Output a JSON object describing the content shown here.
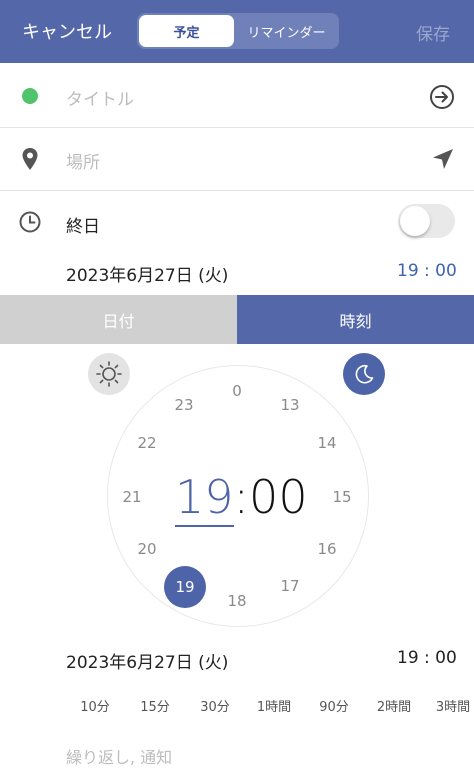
{
  "header": {
    "cancel": "キャンセル",
    "tab_event": "予定",
    "tab_reminder": "リマインダー",
    "save": "保存"
  },
  "title_row": {
    "placeholder": "タイトル",
    "color_dot": "#4fc46c",
    "icon": "arrow-right-circle-icon"
  },
  "location_row": {
    "placeholder": "場所",
    "icon": "location-arrow-icon"
  },
  "allday_row": {
    "label": "終日",
    "toggle_on": false
  },
  "start": {
    "date": "2023年6月27日 (火)",
    "time": "19 : 00"
  },
  "picker_tabs": {
    "date": "日付",
    "time": "時刻",
    "active": "time"
  },
  "clock": {
    "hours": [
      "0",
      "13",
      "14",
      "15",
      "16",
      "17",
      "18",
      "19",
      "20",
      "21",
      "22",
      "23"
    ],
    "selected_hour": "19",
    "display_hour": "19",
    "display_colon": ":",
    "display_minute": "00",
    "period": "pm"
  },
  "end": {
    "date": "2023年6月27日 (火)",
    "time": "19 : 00"
  },
  "durations": [
    "10分",
    "15分",
    "30分",
    "1時間",
    "90分",
    "2時間",
    "3時間"
  ],
  "repeat_placeholder": "繰り返し, 通知",
  "colors": {
    "accent": "#5467a8",
    "time_blue": "#3d64b0"
  }
}
